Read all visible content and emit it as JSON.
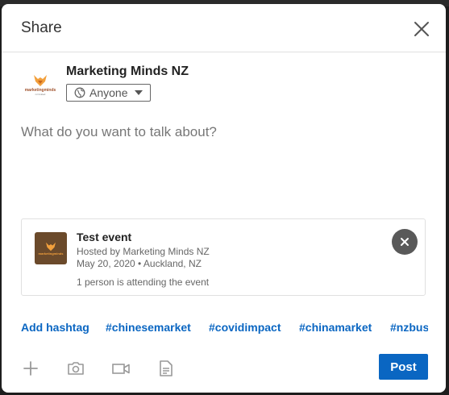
{
  "dialog": {
    "title": "Share",
    "close_icon": "close-icon"
  },
  "author": {
    "name": "Marketing Minds NZ",
    "logo_text": "marketingminds",
    "logo_subtext": "nz limited",
    "audience_label": "Anyone",
    "audience_icon": "globe-icon"
  },
  "composer": {
    "placeholder": "What do you want to talk about?"
  },
  "event": {
    "title": "Test event",
    "host": "Hosted by Marketing Minds NZ",
    "date_location": "May 20, 2020 • Auckland, NZ",
    "attendance": "1 person is attending the event",
    "logo_text": "marketingminds",
    "remove_icon": "close-icon"
  },
  "hashtags": {
    "add_label": "Add hashtag",
    "items": [
      "#chinesemarket",
      "#covidimpact",
      "#chinamarket",
      "#nzbus"
    ]
  },
  "toolbar": {
    "icons": [
      "plus-icon",
      "camera-icon",
      "video-icon",
      "document-icon"
    ],
    "post_label": "Post"
  },
  "colors": {
    "accent": "#0a66c2",
    "remove_button": "#595959"
  }
}
